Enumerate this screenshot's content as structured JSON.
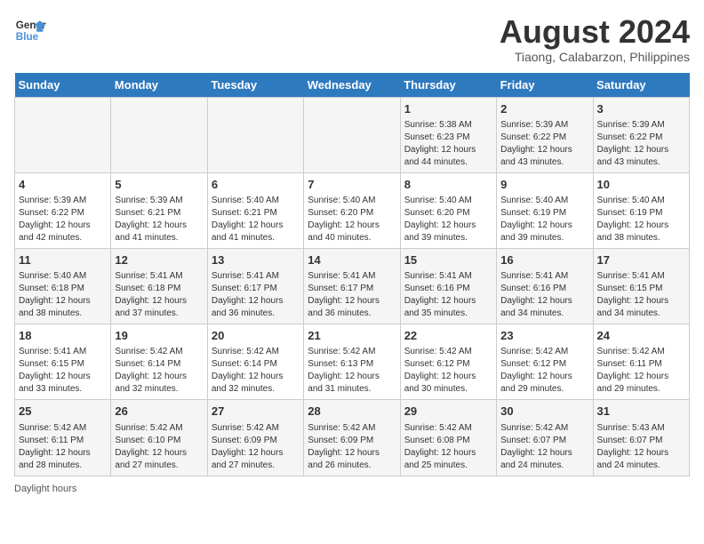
{
  "header": {
    "logo_line1": "General",
    "logo_line2": "Blue",
    "main_title": "August 2024",
    "subtitle": "Tiaong, Calabarzon, Philippines"
  },
  "days_of_week": [
    "Sunday",
    "Monday",
    "Tuesday",
    "Wednesday",
    "Thursday",
    "Friday",
    "Saturday"
  ],
  "weeks": [
    [
      {
        "day": "",
        "info": ""
      },
      {
        "day": "",
        "info": ""
      },
      {
        "day": "",
        "info": ""
      },
      {
        "day": "",
        "info": ""
      },
      {
        "day": "1",
        "info": "Sunrise: 5:38 AM\nSunset: 6:23 PM\nDaylight: 12 hours and 44 minutes."
      },
      {
        "day": "2",
        "info": "Sunrise: 5:39 AM\nSunset: 6:22 PM\nDaylight: 12 hours and 43 minutes."
      },
      {
        "day": "3",
        "info": "Sunrise: 5:39 AM\nSunset: 6:22 PM\nDaylight: 12 hours and 43 minutes."
      }
    ],
    [
      {
        "day": "4",
        "info": "Sunrise: 5:39 AM\nSunset: 6:22 PM\nDaylight: 12 hours and 42 minutes."
      },
      {
        "day": "5",
        "info": "Sunrise: 5:39 AM\nSunset: 6:21 PM\nDaylight: 12 hours and 41 minutes."
      },
      {
        "day": "6",
        "info": "Sunrise: 5:40 AM\nSunset: 6:21 PM\nDaylight: 12 hours and 41 minutes."
      },
      {
        "day": "7",
        "info": "Sunrise: 5:40 AM\nSunset: 6:20 PM\nDaylight: 12 hours and 40 minutes."
      },
      {
        "day": "8",
        "info": "Sunrise: 5:40 AM\nSunset: 6:20 PM\nDaylight: 12 hours and 39 minutes."
      },
      {
        "day": "9",
        "info": "Sunrise: 5:40 AM\nSunset: 6:19 PM\nDaylight: 12 hours and 39 minutes."
      },
      {
        "day": "10",
        "info": "Sunrise: 5:40 AM\nSunset: 6:19 PM\nDaylight: 12 hours and 38 minutes."
      }
    ],
    [
      {
        "day": "11",
        "info": "Sunrise: 5:40 AM\nSunset: 6:18 PM\nDaylight: 12 hours and 38 minutes."
      },
      {
        "day": "12",
        "info": "Sunrise: 5:41 AM\nSunset: 6:18 PM\nDaylight: 12 hours and 37 minutes."
      },
      {
        "day": "13",
        "info": "Sunrise: 5:41 AM\nSunset: 6:17 PM\nDaylight: 12 hours and 36 minutes."
      },
      {
        "day": "14",
        "info": "Sunrise: 5:41 AM\nSunset: 6:17 PM\nDaylight: 12 hours and 36 minutes."
      },
      {
        "day": "15",
        "info": "Sunrise: 5:41 AM\nSunset: 6:16 PM\nDaylight: 12 hours and 35 minutes."
      },
      {
        "day": "16",
        "info": "Sunrise: 5:41 AM\nSunset: 6:16 PM\nDaylight: 12 hours and 34 minutes."
      },
      {
        "day": "17",
        "info": "Sunrise: 5:41 AM\nSunset: 6:15 PM\nDaylight: 12 hours and 34 minutes."
      }
    ],
    [
      {
        "day": "18",
        "info": "Sunrise: 5:41 AM\nSunset: 6:15 PM\nDaylight: 12 hours and 33 minutes."
      },
      {
        "day": "19",
        "info": "Sunrise: 5:42 AM\nSunset: 6:14 PM\nDaylight: 12 hours and 32 minutes."
      },
      {
        "day": "20",
        "info": "Sunrise: 5:42 AM\nSunset: 6:14 PM\nDaylight: 12 hours and 32 minutes."
      },
      {
        "day": "21",
        "info": "Sunrise: 5:42 AM\nSunset: 6:13 PM\nDaylight: 12 hours and 31 minutes."
      },
      {
        "day": "22",
        "info": "Sunrise: 5:42 AM\nSunset: 6:12 PM\nDaylight: 12 hours and 30 minutes."
      },
      {
        "day": "23",
        "info": "Sunrise: 5:42 AM\nSunset: 6:12 PM\nDaylight: 12 hours and 29 minutes."
      },
      {
        "day": "24",
        "info": "Sunrise: 5:42 AM\nSunset: 6:11 PM\nDaylight: 12 hours and 29 minutes."
      }
    ],
    [
      {
        "day": "25",
        "info": "Sunrise: 5:42 AM\nSunset: 6:11 PM\nDaylight: 12 hours and 28 minutes."
      },
      {
        "day": "26",
        "info": "Sunrise: 5:42 AM\nSunset: 6:10 PM\nDaylight: 12 hours and 27 minutes."
      },
      {
        "day": "27",
        "info": "Sunrise: 5:42 AM\nSunset: 6:09 PM\nDaylight: 12 hours and 27 minutes."
      },
      {
        "day": "28",
        "info": "Sunrise: 5:42 AM\nSunset: 6:09 PM\nDaylight: 12 hours and 26 minutes."
      },
      {
        "day": "29",
        "info": "Sunrise: 5:42 AM\nSunset: 6:08 PM\nDaylight: 12 hours and 25 minutes."
      },
      {
        "day": "30",
        "info": "Sunrise: 5:42 AM\nSunset: 6:07 PM\nDaylight: 12 hours and 24 minutes."
      },
      {
        "day": "31",
        "info": "Sunrise: 5:43 AM\nSunset: 6:07 PM\nDaylight: 12 hours and 24 minutes."
      }
    ]
  ],
  "footer": {
    "daylight_hours_label": "Daylight hours"
  }
}
